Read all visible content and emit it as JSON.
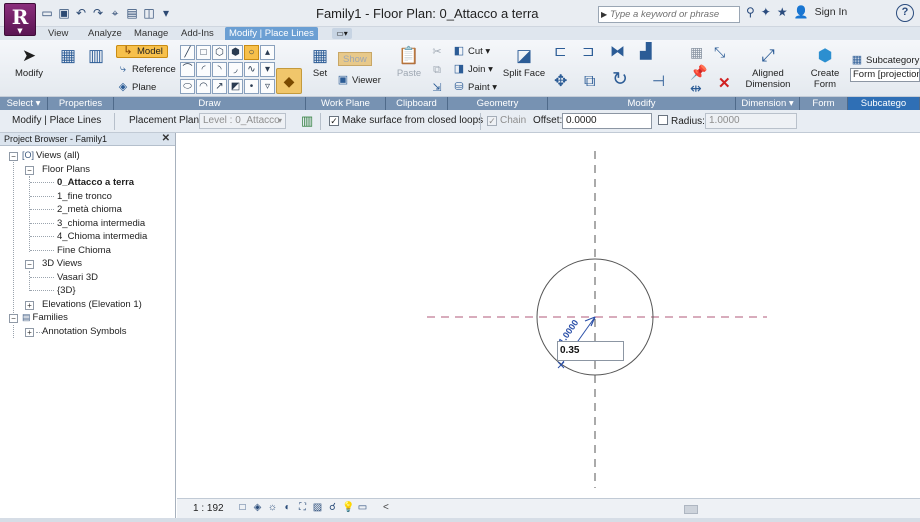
{
  "app": {
    "logo_letter": "R",
    "window_title": "Family1 - Floor Plan: 0_Attacco a terra",
    "search_placeholder": "Type a keyword or phrase",
    "sign_in": "Sign In",
    "help": "?"
  },
  "tabs": [
    {
      "label": "View"
    },
    {
      "label": "Analyze"
    },
    {
      "label": "Manage"
    },
    {
      "label": "Add-Ins"
    },
    {
      "label": "Modify | Place Lines"
    }
  ],
  "ribbon": {
    "modify_label": "Modify",
    "draw": {
      "model": "Model",
      "reference": "Reference",
      "plane": "Plane"
    },
    "work_plane": {
      "set": "Set",
      "show": "Show",
      "viewer": "Viewer"
    },
    "clipboard": {
      "paste": "Paste"
    },
    "geometry": {
      "cut": "Cut",
      "join": "Join",
      "paint": "Paint",
      "split_face": "Split Face"
    },
    "dimension": {
      "aligned_line1": "Aligned",
      "aligned_line2": "Dimension"
    },
    "form": {
      "create_line1": "Create",
      "create_line2": "Form"
    },
    "subcategory": {
      "label": "Subcategory:",
      "value": "Form [projection"
    }
  },
  "panels": [
    {
      "label": "Select ▾"
    },
    {
      "label": "Properties"
    },
    {
      "label": "Draw"
    },
    {
      "label": "Work Plane"
    },
    {
      "label": "Clipboard"
    },
    {
      "label": "Geometry"
    },
    {
      "label": "Modify"
    },
    {
      "label": "Dimension ▾"
    },
    {
      "label": "Form"
    },
    {
      "label": "Subcatego"
    }
  ],
  "options_bar": {
    "context": "Modify | Place Lines",
    "placement_plane_label": "Placement Plane:",
    "placement_plane_value": "Level : 0_Attacco",
    "make_surface": "Make surface from closed loops",
    "make_surface_checked": true,
    "chain": "Chain",
    "chain_checked": true,
    "offset_label": "Offset:",
    "offset_value": "0.0000",
    "radius_label": "Radius:",
    "radius_checked": false,
    "radius_value": "1.0000"
  },
  "browser": {
    "title": "Project Browser - Family1",
    "close": "✕",
    "items": [
      {
        "label": "Views (all)"
      },
      {
        "label": "Floor Plans"
      },
      {
        "label": "0_Attacco a terra"
      },
      {
        "label": "1_fine tronco"
      },
      {
        "label": "2_metà chioma"
      },
      {
        "label": "3_chioma intermedia"
      },
      {
        "label": "4_Chioma intermedia"
      },
      {
        "label": "Fine Chioma"
      },
      {
        "label": "3D Views"
      },
      {
        "label": "Vasari 3D"
      },
      {
        "label": "{3D}"
      },
      {
        "label": "Elevations (Elevation 1)"
      },
      {
        "label": "Families"
      },
      {
        "label": "Annotation Symbols"
      }
    ]
  },
  "canvas": {
    "radius_dimension_text": "1.0000",
    "dimension_input_value": "0.35"
  },
  "view_bar": {
    "scale": "1 : 192"
  },
  "colors": {
    "active_tab": "#6b9fd3",
    "panel_bar": "#6d8aab",
    "reference_plane": "#b05a7a",
    "dimension": "#2a4fa8"
  }
}
